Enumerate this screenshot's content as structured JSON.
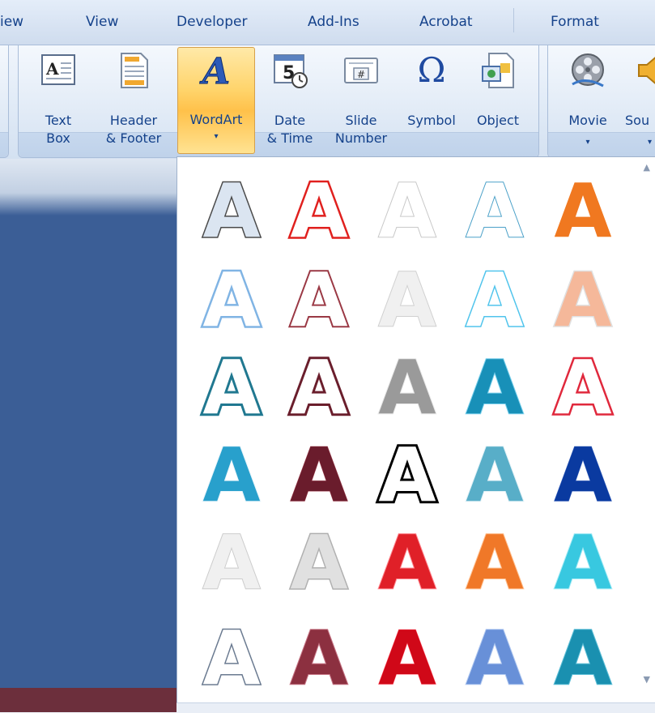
{
  "tabs": [
    {
      "label": "iew"
    },
    {
      "label": "View"
    },
    {
      "label": "Developer"
    },
    {
      "label": "Add-Ins"
    },
    {
      "label": "Acrobat"
    },
    {
      "label": "Format"
    }
  ],
  "ribbon": {
    "text_box": {
      "line1": "Text",
      "line2": "Box"
    },
    "header_footer": {
      "line1": "Header",
      "line2": "& Footer"
    },
    "wordart": {
      "line1": "WordArt",
      "arrow": "▾"
    },
    "date_time": {
      "line1": "Date",
      "line2": "& Time"
    },
    "slide_number": {
      "line1": "Slide",
      "line2": "Number"
    },
    "symbol": {
      "line1": "Symbol",
      "glyph": "Ω"
    },
    "object": {
      "line1": "Object"
    },
    "movie": {
      "line1": "Movie",
      "arrow": "▾"
    },
    "sound": {
      "line1": "Sou",
      "arrow": "▾"
    },
    "icon_text": {
      "textbox_glyph": "A",
      "date_glyph": "5",
      "number_glyph": "#"
    }
  },
  "gallery": {
    "glyph": "A",
    "scroll_up": "▲",
    "scroll_down": "▼",
    "styles": [
      {
        "fill": "#dbe5f1",
        "stroke": "#4a4a4a",
        "sw": 3
      },
      {
        "fill": "#ffffff",
        "stroke": "#e0201e",
        "sw": 5
      },
      {
        "fill": "#ffffff",
        "stroke": "#c8c8c8",
        "sw": 2
      },
      {
        "fill": "#ffffff",
        "stroke": "#4aa0c8",
        "sw": 2
      },
      {
        "fill": "#f07820",
        "stroke": "#ffffff",
        "sw": 2
      },
      {
        "fill": "#ffffff",
        "stroke": "#80b4e4",
        "sw": 5
      },
      {
        "fill": "#ffffff",
        "stroke": "#9a3844",
        "sw": 4
      },
      {
        "fill": "#f0f0f0",
        "stroke": "#d0d0d0",
        "sw": 2
      },
      {
        "fill": "#ffffff",
        "stroke": "#50c4ec",
        "sw": 3
      },
      {
        "fill": "#f5b89a",
        "stroke": "#e0e0e0",
        "sw": 3
      },
      {
        "fill": "#ffffff",
        "stroke": "#207890",
        "sw": 6
      },
      {
        "fill": "#ffffff",
        "stroke": "#6a1e2c",
        "sw": 6
      },
      {
        "fill": "#9a9a9a",
        "stroke": "#e8e8e8",
        "sw": 2
      },
      {
        "fill": "#1890b8",
        "stroke": "#7ad0ec",
        "sw": 2
      },
      {
        "fill": "#ffffff",
        "stroke": "#e0283c",
        "sw": 5
      },
      {
        "fill": "#28a0cc",
        "stroke": "#e8f4fa",
        "sw": 2
      },
      {
        "fill": "#6a1c2c",
        "stroke": "#a04050",
        "sw": 1
      },
      {
        "fill": "#ffffff",
        "stroke": "#000000",
        "sw": 6
      },
      {
        "fill": "#58aec8",
        "stroke": "#e0f0f6",
        "sw": 2
      },
      {
        "fill": "#0a3aa0",
        "stroke": "#4068c0",
        "sw": 1
      },
      {
        "fill": "#f0f0f0",
        "stroke": "#cccccc",
        "sw": 2
      },
      {
        "fill": "#e0e0e0",
        "stroke": "#b0b0b0",
        "sw": 3
      },
      {
        "fill": "#e02028",
        "stroke": "#ff8890",
        "sw": 2
      },
      {
        "fill": "#f07828",
        "stroke": "#ffc090",
        "sw": 2
      },
      {
        "fill": "#38c8e0",
        "stroke": "#a8ecf6",
        "sw": 2
      },
      {
        "fill": "#ffffff",
        "stroke": "#6a7a90",
        "sw": 3
      },
      {
        "fill": "#8c3040",
        "stroke": "#c87888",
        "sw": 2
      },
      {
        "fill": "#d00818",
        "stroke": "#ff5060",
        "sw": 1
      },
      {
        "fill": "#6890d8",
        "stroke": "#b0c8f0",
        "sw": 2
      },
      {
        "fill": "#1a90b0",
        "stroke": "#60c0d8",
        "sw": 2
      }
    ]
  }
}
